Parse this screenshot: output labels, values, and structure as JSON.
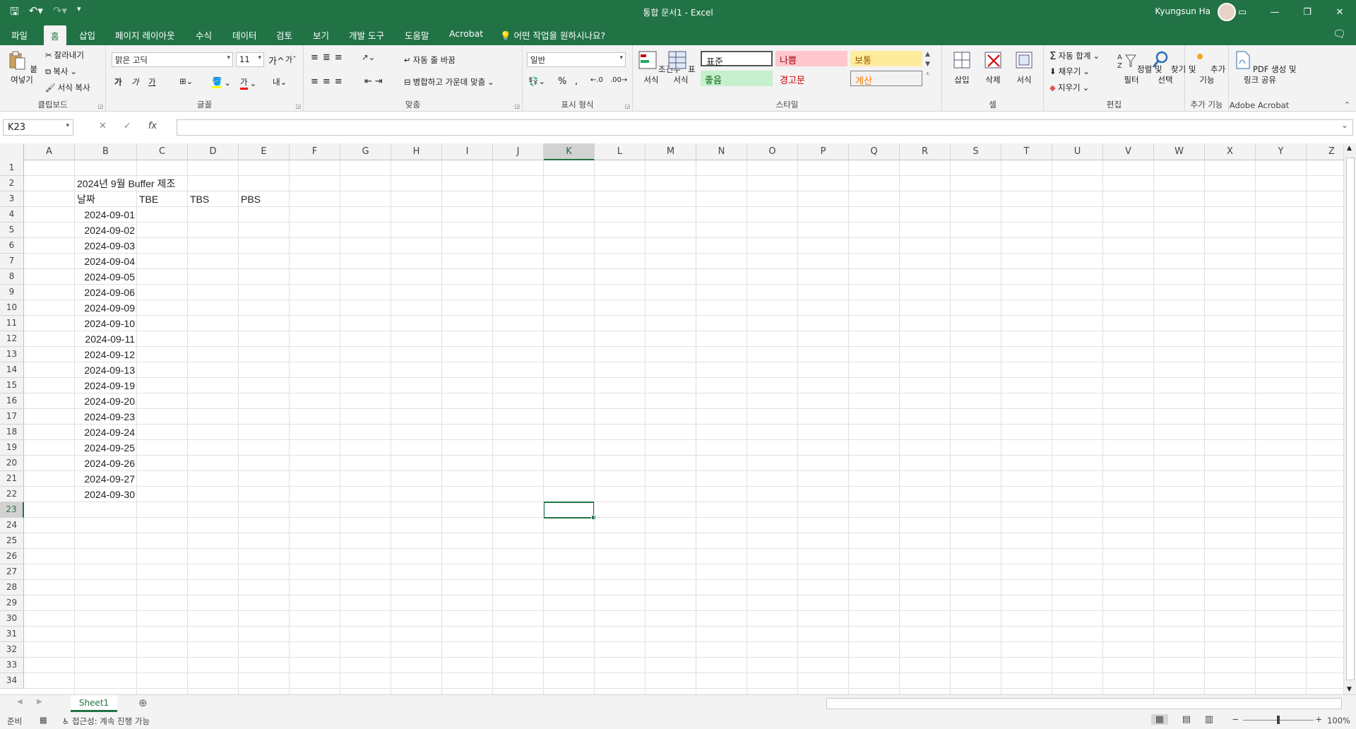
{
  "window": {
    "title": "통합 문서1  -  Excel",
    "user": "Kyungsun Ha"
  },
  "tabs": [
    "파일",
    "홈",
    "삽입",
    "페이지 레이아웃",
    "수식",
    "데이터",
    "검토",
    "보기",
    "개발 도구",
    "도움말",
    "Acrobat"
  ],
  "tell_me": "어떤 작업을 원하시나요?",
  "ribbon": {
    "clipboard": {
      "paste": "붙여넣기",
      "cut": "잘라내기",
      "copy": "복사",
      "format_painter": "서식 복사",
      "label": "클립보드"
    },
    "font": {
      "name": "맑은 고딕",
      "size": "11",
      "label": "글꼴",
      "bold": "가",
      "italic": "가",
      "underline": "가"
    },
    "align": {
      "wrap": "자동 줄 바꿈",
      "merge": "병합하고 가운데 맞춤",
      "label": "맞춤"
    },
    "number": {
      "format": "일반",
      "label": "표시 형식"
    },
    "styles": {
      "cond": "조건부\n서식",
      "table": "표\n서식",
      "normal": "표준",
      "bad": "나쁨",
      "neutral": "보통",
      "good": "좋음",
      "warn": "경고문",
      "calc": "계산",
      "label": "스타일"
    },
    "cells": {
      "insert": "삽입",
      "delete": "삭제",
      "format": "서식",
      "label": "셀"
    },
    "editing": {
      "autosum": "자동 합계",
      "fill": "채우기",
      "clear": "지우기",
      "sort": "정렬 및\n필터",
      "find": "찾기 및\n선택",
      "label": "편집"
    },
    "addins": {
      "btn": "추가\n기능",
      "label": "추가 기능"
    },
    "acrobat": {
      "btn": "PDF 생성 및\n링크 공유",
      "label": "Adobe Acrobat"
    },
    "colors": {
      "accent": "#217346",
      "bad": "#ffc7ce",
      "good": "#c6efce",
      "neutral": "#ffeb9c",
      "calc": "#f2f2f2"
    }
  },
  "formula_bar": {
    "name_box": "K23",
    "value": ""
  },
  "columns": [
    "A",
    "B",
    "C",
    "D",
    "E",
    "F",
    "G",
    "H",
    "I",
    "J",
    "K",
    "L",
    "M",
    "N",
    "O",
    "P",
    "Q",
    "R",
    "S",
    "T",
    "U",
    "V",
    "W",
    "X",
    "Y",
    "Z"
  ],
  "selected_column": "K",
  "rows": [
    "1",
    "2",
    "3",
    "4",
    "5",
    "6",
    "7",
    "8",
    "9",
    "10",
    "11",
    "12",
    "13",
    "14",
    "15",
    "16",
    "17",
    "18",
    "19",
    "20",
    "21",
    "22",
    "23",
    "24",
    "25",
    "26",
    "27",
    "28",
    "29",
    "30",
    "31",
    "32",
    "33",
    "34"
  ],
  "selected_row": "23",
  "sheet": {
    "title": "2024년 9월 Buffer 제조",
    "headers": [
      "날짜",
      "TBE",
      "TBS",
      "PBS"
    ],
    "dates": [
      "2024-09-01",
      "2024-09-02",
      "2024-09-03",
      "2024-09-04",
      "2024-09-05",
      "2024-09-06",
      "2024-09-09",
      "2024-09-10",
      "2024-09-11",
      "2024-09-12",
      "2024-09-13",
      "2024-09-19",
      "2024-09-20",
      "2024-09-23",
      "2024-09-24",
      "2024-09-25",
      "2024-09-26",
      "2024-09-27",
      "2024-09-30"
    ]
  },
  "sheet_tab": "Sheet1",
  "status": {
    "ready": "준비",
    "accessibility": "접근성: 계속 진행 가능",
    "zoom": "100%"
  }
}
